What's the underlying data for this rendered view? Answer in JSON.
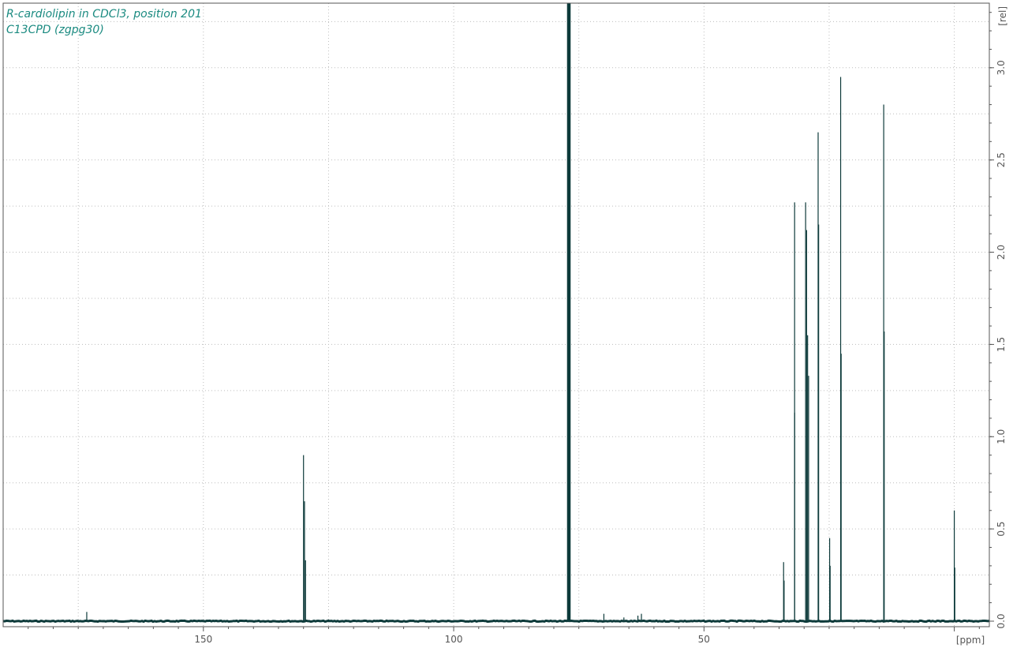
{
  "colors": {
    "spectrum": "#0d3a3a",
    "title": "#1a8a80",
    "grid": "#bdbdbd",
    "axis": "#555555"
  },
  "chart_data": {
    "type": "line",
    "title": "R-cardiolipin in CDCl3, position 201",
    "subtitle": "C13CPD (zgpg30)",
    "xlabel": "",
    "ylabel": "",
    "x_unit": "[ppm]",
    "y_unit": "[rel]",
    "xlim": [
      190,
      -7
    ],
    "ylim": [
      -0.03,
      3.35
    ],
    "x_reversed": true,
    "x_ticks": [
      150,
      100,
      50,
      0
    ],
    "y_ticks": [
      0.0,
      0.5,
      1.0,
      1.5,
      2.0,
      2.5,
      3.0
    ],
    "y_tick_labels": [
      "0.0",
      "0.5",
      "1.0",
      "1.5",
      "2.0",
      "2.5",
      "3.0"
    ],
    "x_ticks_labeled": [
      "150",
      "100",
      "50"
    ],
    "x_unit_position": "right",
    "y_unit_position": "top",
    "x_axis_label_side": "bottom",
    "y_axis_label_side": "right",
    "grid": true,
    "peaks": [
      {
        "ppm": 173.3,
        "intensity": 0.05
      },
      {
        "ppm": 130.0,
        "intensity": 0.9
      },
      {
        "ppm": 129.8,
        "intensity": 0.65
      },
      {
        "ppm": 129.6,
        "intensity": 0.33
      },
      {
        "ppm": 77.2,
        "intensity": 3.4
      },
      {
        "ppm": 77.0,
        "intensity": 3.4
      },
      {
        "ppm": 76.8,
        "intensity": 3.4
      },
      {
        "ppm": 70.0,
        "intensity": 0.04
      },
      {
        "ppm": 66.0,
        "intensity": 0.02
      },
      {
        "ppm": 63.2,
        "intensity": 0.03
      },
      {
        "ppm": 62.5,
        "intensity": 0.04
      },
      {
        "ppm": 34.1,
        "intensity": 0.32
      },
      {
        "ppm": 34.0,
        "intensity": 0.22
      },
      {
        "ppm": 31.9,
        "intensity": 2.27
      },
      {
        "ppm": 31.9,
        "intensity": 1.13
      },
      {
        "ppm": 29.7,
        "intensity": 2.27
      },
      {
        "ppm": 29.5,
        "intensity": 2.12
      },
      {
        "ppm": 29.3,
        "intensity": 1.55
      },
      {
        "ppm": 29.1,
        "intensity": 1.33
      },
      {
        "ppm": 27.2,
        "intensity": 2.65
      },
      {
        "ppm": 27.1,
        "intensity": 2.15
      },
      {
        "ppm": 24.9,
        "intensity": 0.45
      },
      {
        "ppm": 24.8,
        "intensity": 0.3
      },
      {
        "ppm": 22.7,
        "intensity": 2.95
      },
      {
        "ppm": 22.6,
        "intensity": 1.45
      },
      {
        "ppm": 14.1,
        "intensity": 2.8
      },
      {
        "ppm": 14.0,
        "intensity": 1.57
      },
      {
        "ppm": 0.0,
        "intensity": 0.6
      },
      {
        "ppm": -0.1,
        "intensity": 0.29
      }
    ]
  }
}
